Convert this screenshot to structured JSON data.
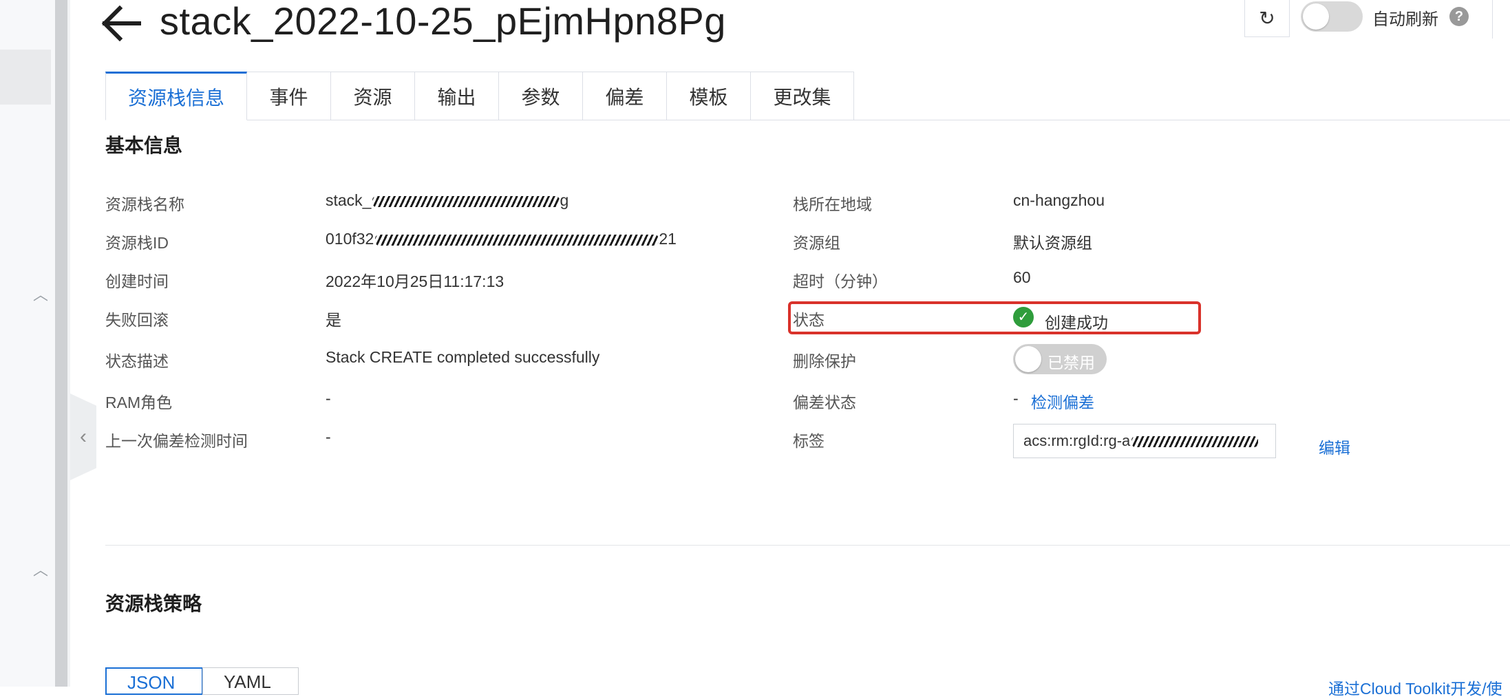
{
  "header": {
    "title": "stack_2022-10-25_pEjmHpn8Pg",
    "auto_refresh_label": "自动刷新",
    "help_glyph": "?",
    "refresh_glyph": "↻"
  },
  "tabs": [
    {
      "label": "资源栈信息",
      "active": true
    },
    {
      "label": "事件"
    },
    {
      "label": "资源"
    },
    {
      "label": "输出"
    },
    {
      "label": "参数"
    },
    {
      "label": "偏差"
    },
    {
      "label": "模板"
    },
    {
      "label": "更改集"
    }
  ],
  "basic_info": {
    "section_title": "基本信息",
    "left": [
      {
        "label": "资源栈名称",
        "value": "stack_",
        "value_tail": "g"
      },
      {
        "label": "资源栈ID",
        "value": "010f32",
        "value_tail": "21"
      },
      {
        "label": "创建时间",
        "value": "2022年10月25日11:17:13"
      },
      {
        "label": "失败回滚",
        "value": "是"
      },
      {
        "label": "状态描述",
        "value": "Stack CREATE completed successfully"
      },
      {
        "label": "RAM角色",
        "value": "-"
      },
      {
        "label": "上一次偏差检测时间",
        "value": "-"
      }
    ],
    "right": {
      "region_label": "栈所在地域",
      "region_value": "cn-hangzhou",
      "group_label": "资源组",
      "group_value": "默认资源组",
      "timeout_label": "超时（分钟）",
      "timeout_value": "60",
      "status_label": "状态",
      "status_value": "创建成功",
      "delete_protect_label": "删除保护",
      "delete_protect_value": "已禁用",
      "drift_label": "偏差状态",
      "drift_value": "-",
      "drift_link": "检测偏差",
      "tags_label": "标签",
      "tags_value": "acs:rm:rgId:rg-a",
      "tags_edit": "编辑"
    }
  },
  "policy": {
    "section_title": "资源栈策略",
    "formats": [
      "JSON",
      "YAML"
    ],
    "toolkit_link": "通过Cloud Toolkit开发/使"
  },
  "colors": {
    "accent": "#1a6fd5",
    "success": "#2f9d3c",
    "highlight": "#d9322b"
  }
}
